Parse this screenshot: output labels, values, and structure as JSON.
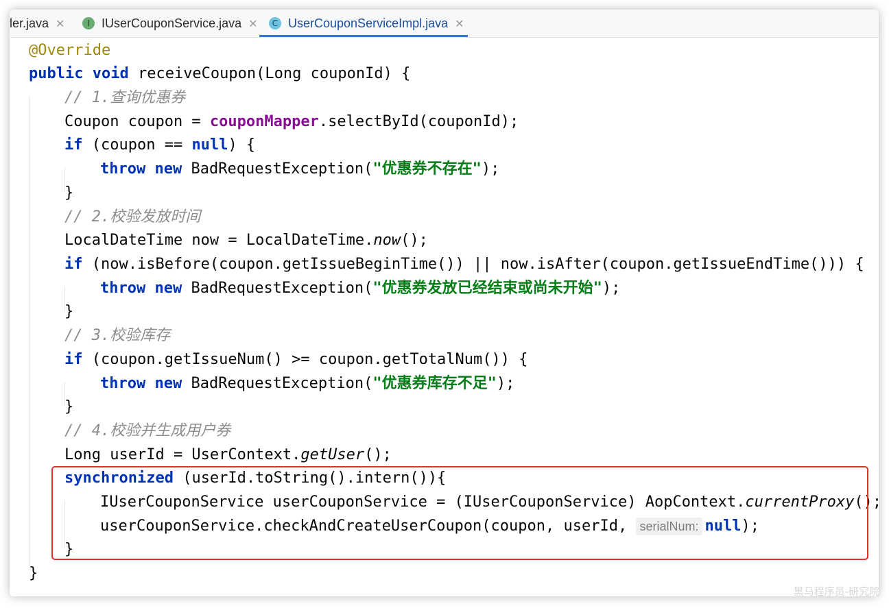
{
  "tabs": [
    {
      "label": "ler.java",
      "icon": "none",
      "active": false
    },
    {
      "label": "IUserCouponService.java",
      "icon": "interface-icon",
      "badge": "I",
      "active": false
    },
    {
      "label": "UserCouponServiceImpl.java",
      "icon": "class-icon",
      "badge": "C",
      "active": true
    }
  ],
  "code": {
    "l1": "@Override",
    "l2_kw1": "public",
    "l2_kw2": "void",
    "l2_rest": " receiveCoupon(Long couponId) {",
    "l3": "// 1.查询优惠券",
    "l4_a": "Coupon coupon = ",
    "l4_field": "couponMapper",
    "l4_b": ".selectById(couponId);",
    "l5_kw": "if",
    "l5_a": " (coupon == ",
    "l5_null": "null",
    "l5_b": ") {",
    "l6_kw1": "throw",
    "l6_kw2": "new",
    "l6_a": " BadRequestException(",
    "l6_str": "\"优惠券不存在\"",
    "l6_b": ");",
    "l7": "}",
    "l8": "// 2.校验发放时间",
    "l9_a": "LocalDateTime now = LocalDateTime.",
    "l9_it": "now",
    "l9_b": "();",
    "l10_kw": "if",
    "l10_a": " (now.isBefore(coupon.getIssueBeginTime()) || now.isAfter(coupon.getIssueEndTime())) {",
    "l11_kw1": "throw",
    "l11_kw2": "new",
    "l11_a": " BadRequestException(",
    "l11_str": "\"优惠券发放已经结束或尚未开始\"",
    "l11_b": ");",
    "l12": "}",
    "l13": "// 3.校验库存",
    "l14_kw": "if",
    "l14_a": " (coupon.getIssueNum() >= coupon.getTotalNum()) {",
    "l15_kw1": "throw",
    "l15_kw2": "new",
    "l15_a": " BadRequestException(",
    "l15_str": "\"优惠券库存不足\"",
    "l15_b": ");",
    "l16": "}",
    "l17": "// 4.校验并生成用户券",
    "l18_a": "Long userId = UserContext.",
    "l18_it": "getUser",
    "l18_b": "();",
    "l19_kw": "synchronized",
    "l19_a": " (userId.toString().intern()){",
    "l20_a": "IUserCouponService userCouponService = (IUserCouponService) AopContext.",
    "l20_it": "currentProxy",
    "l20_b": "();",
    "l21_a": "userCouponService.checkAndCreateUserCoupon(coupon, userId, ",
    "l21_hint": "serialNum:",
    "l21_null": "null",
    "l21_b": ");",
    "l22": "}",
    "l23": "}"
  },
  "watermark": "黑马程序员-研究院"
}
